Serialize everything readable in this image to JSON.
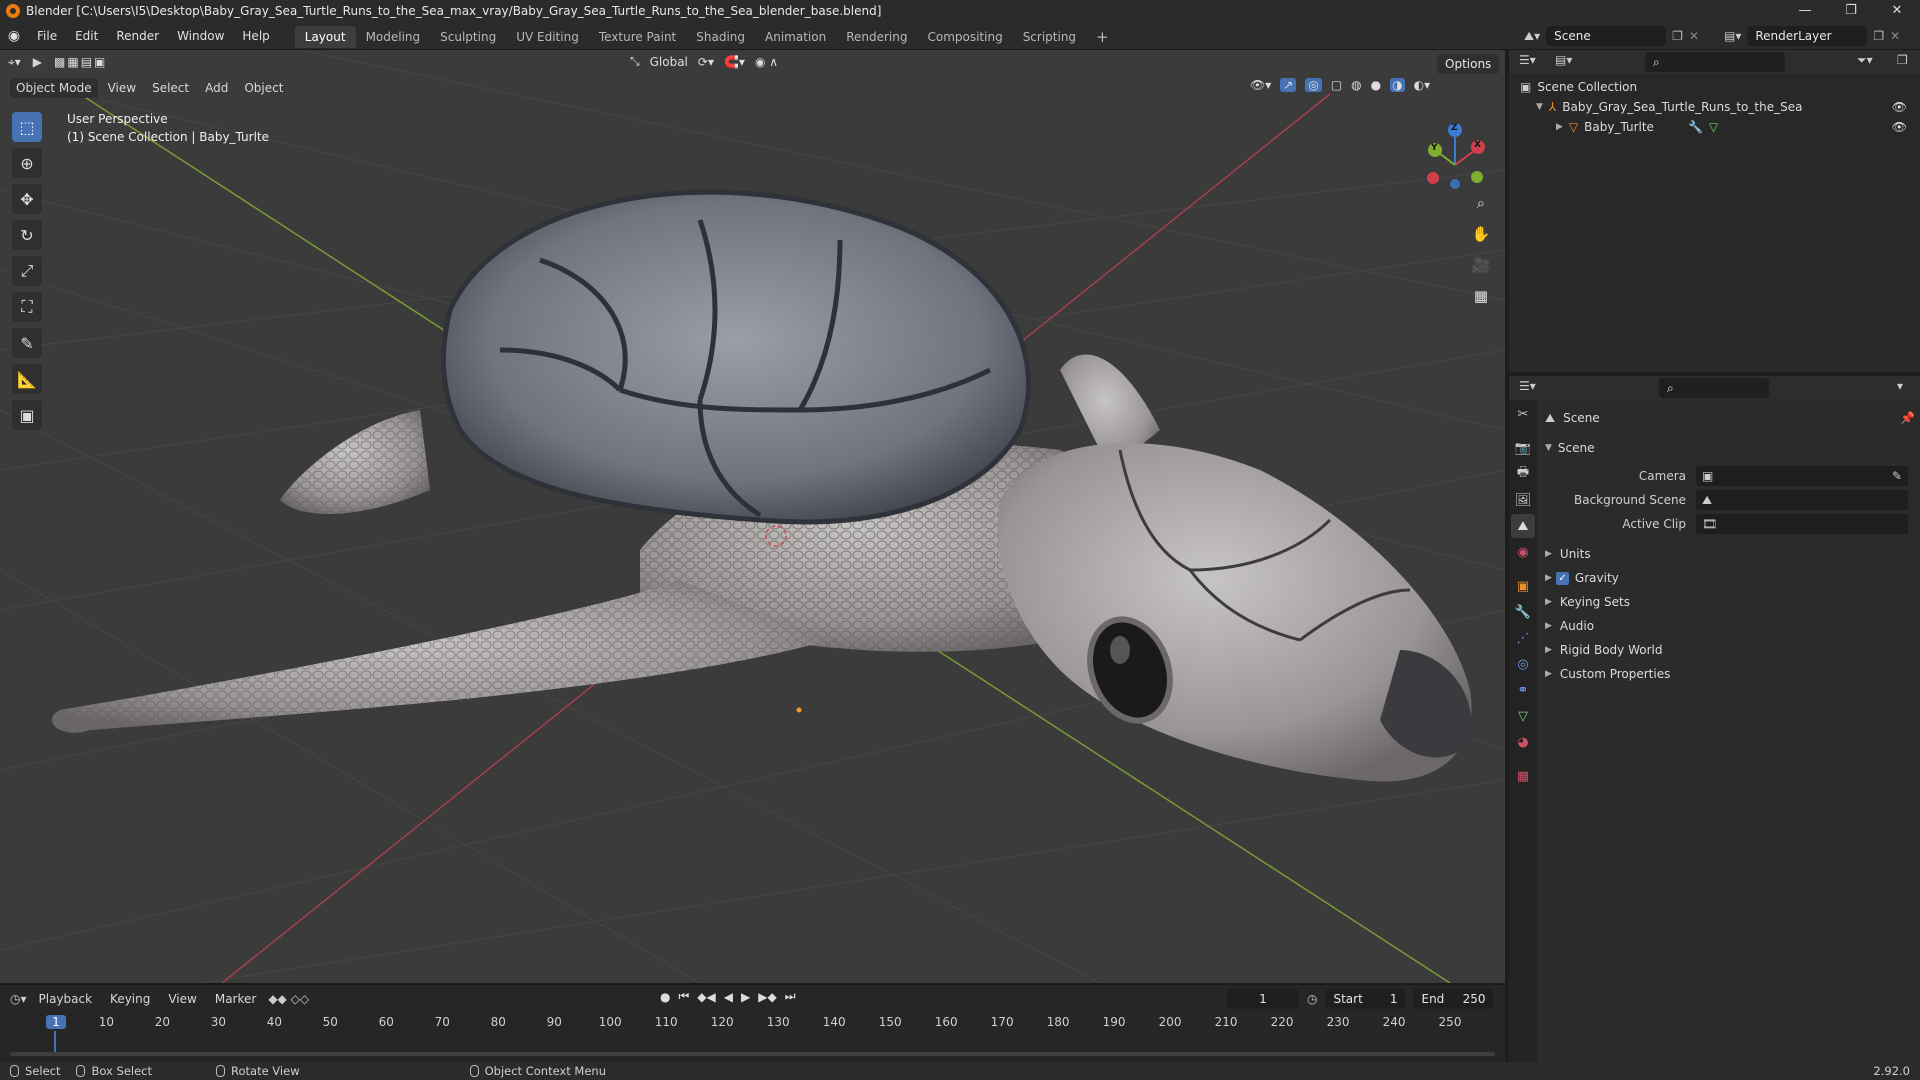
{
  "titlebar": {
    "title": "Blender [C:\\Users\\I5\\Desktop\\Baby_Gray_Sea_Turtle_Runs_to_the_Sea_max_vray/Baby_Gray_Sea_Turtle_Runs_to_the_Sea_blender_base.blend]",
    "minimize": "—",
    "maximize": "❐",
    "close": "✕"
  },
  "menubar": {
    "menus": [
      "File",
      "Edit",
      "Render",
      "Window",
      "Help"
    ],
    "workspaces": [
      "Layout",
      "Modeling",
      "Sculpting",
      "UV Editing",
      "Texture Paint",
      "Shading",
      "Animation",
      "Rendering",
      "Compositing",
      "Scripting"
    ],
    "active_workspace": "Layout",
    "add_workspace": "+",
    "scene_label": "Scene",
    "renderlayer_label": "RenderLayer"
  },
  "viewport": {
    "transform_orientation": "Global",
    "options_label": "Options",
    "mode": "Object Mode",
    "header_menus": [
      "View",
      "Select",
      "Add",
      "Object"
    ],
    "overlay_text_1": "User Perspective",
    "overlay_text_2": "(1) Scene Collection | Baby_Turlte",
    "axis_labels": {
      "x": "X",
      "y": "Y",
      "z": "Z"
    },
    "colors": {
      "x_axis": "#d0404a",
      "y_axis": "#7fae2e",
      "z_axis": "#3b7bd6",
      "background": "#3b3b3b"
    }
  },
  "outliner": {
    "root": "Scene Collection",
    "collection": "Baby_Gray_Sea_Turtle_Runs_to_the_Sea",
    "object": "Baby_Turlte"
  },
  "properties": {
    "context": "Scene",
    "panel_title": "Scene",
    "fields": [
      {
        "label": "Camera",
        "value": ""
      },
      {
        "label": "Background Scene",
        "value": ""
      },
      {
        "label": "Active Clip",
        "value": ""
      }
    ],
    "subpanels": [
      "Units",
      "Gravity",
      "Keying Sets",
      "Audio",
      "Rigid Body World",
      "Custom Properties"
    ],
    "gravity_checked": true
  },
  "timeline": {
    "menus": [
      "Playback",
      "Keying",
      "View",
      "Marker"
    ],
    "current_frame": "1",
    "start_label": "Start",
    "start_value": "1",
    "end_label": "End",
    "end_value": "250",
    "ticks": [
      "1",
      "10",
      "20",
      "30",
      "40",
      "50",
      "60",
      "70",
      "80",
      "90",
      "100",
      "110",
      "120",
      "130",
      "140",
      "150",
      "160",
      "170",
      "180",
      "190",
      "200",
      "210",
      "220",
      "230",
      "240",
      "250"
    ]
  },
  "statusbar": {
    "select": "Select",
    "box_select": "Box Select",
    "rotate_view": "Rotate View",
    "context_menu": "Object Context Menu",
    "version": "2.92.0"
  }
}
